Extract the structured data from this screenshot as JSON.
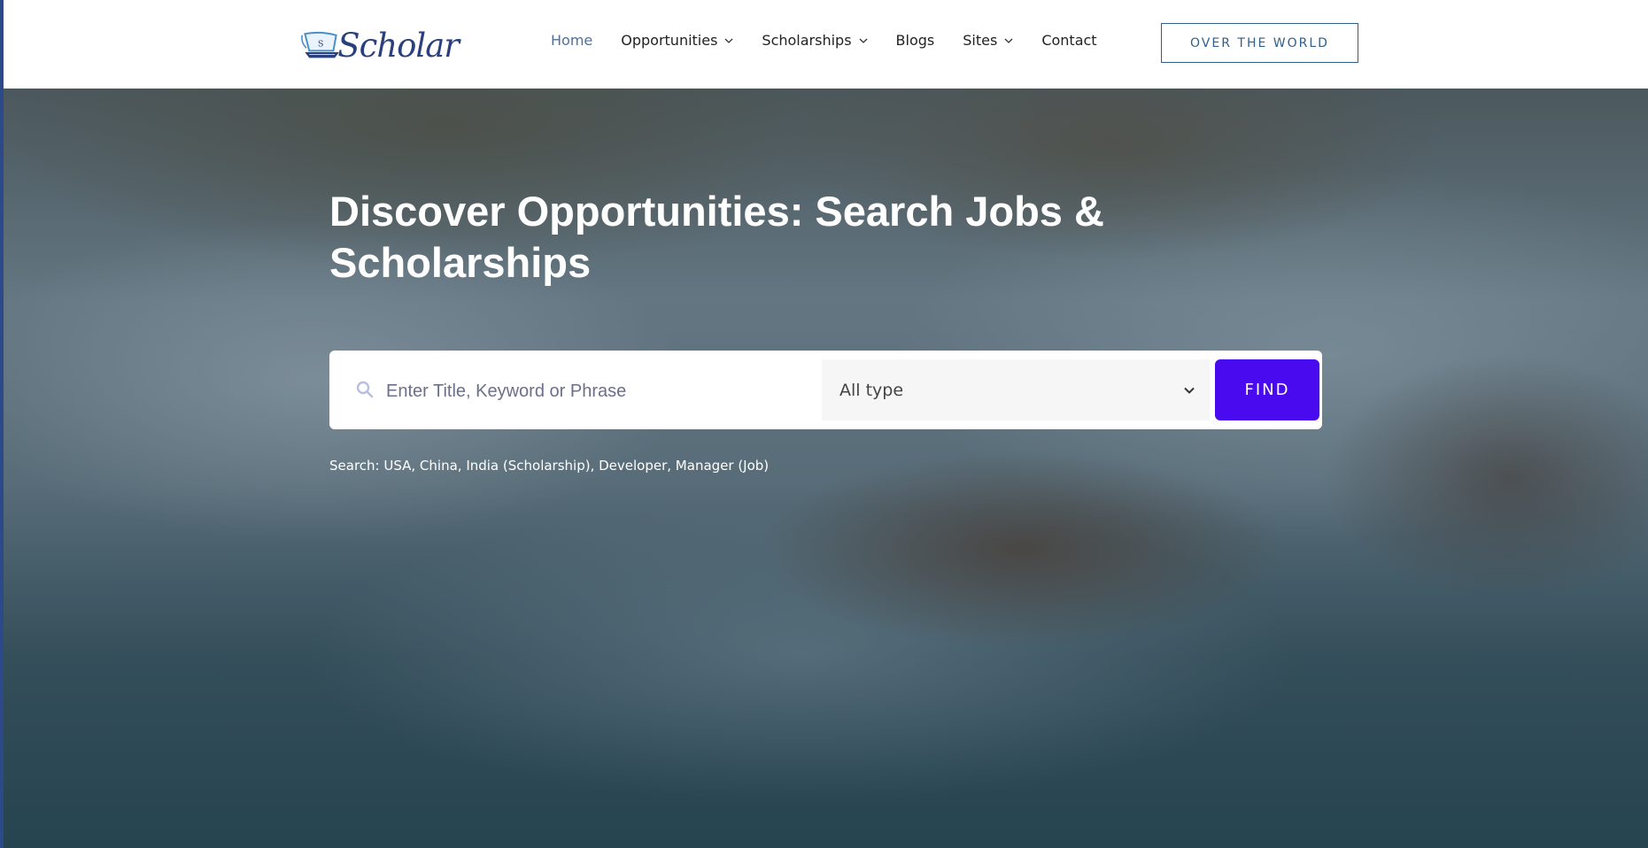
{
  "header": {
    "logo_text": "Scholar",
    "logo_badge": "S",
    "nav": [
      {
        "label": "Home",
        "has_dropdown": false,
        "active": true
      },
      {
        "label": "Opportunities",
        "has_dropdown": true
      },
      {
        "label": "Scholarships",
        "has_dropdown": true
      },
      {
        "label": "Blogs",
        "has_dropdown": false
      },
      {
        "label": "Sites",
        "has_dropdown": true
      },
      {
        "label": "Contact",
        "has_dropdown": false
      }
    ],
    "cta_label": "OVER THE WORLD"
  },
  "hero": {
    "title": "Discover Opportunities: Search Jobs & Scholarships",
    "search": {
      "placeholder": "Enter Title, Keyword or Phrase",
      "type_selected": "All type",
      "find_label": "FIND",
      "icon": "search-icon"
    },
    "hints": "Search: USA, China, India (Scholarship), Developer, Manager (Job)"
  },
  "colors": {
    "brand": "#2a3f7e",
    "find_button": "#4a0aef",
    "nav_active": "#4f6fa0",
    "cta_border": "#2f5f8a"
  }
}
